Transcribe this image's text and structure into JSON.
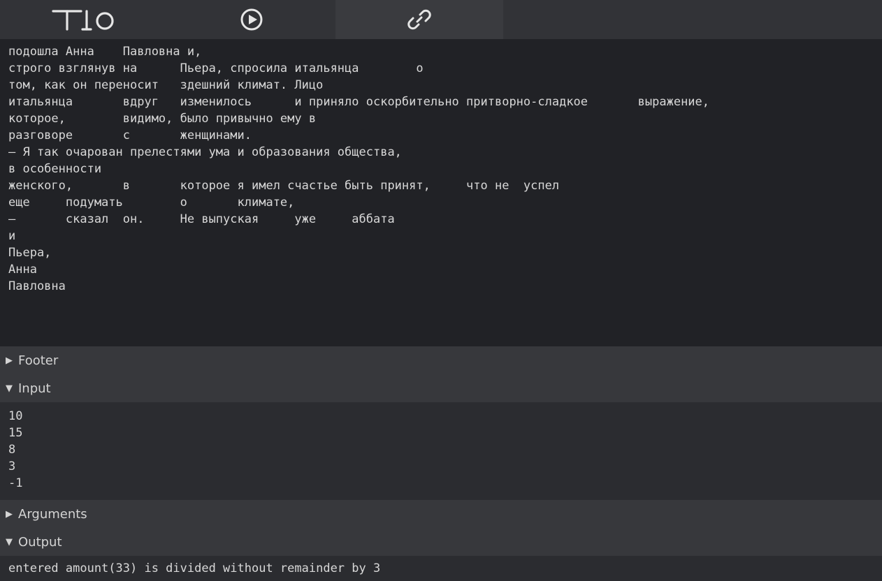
{
  "toolbar": {
    "logo_label": "TIO",
    "run_label": "Run",
    "link_label": "Permalink"
  },
  "sections": {
    "footer": {
      "label": "Footer",
      "expanded": false
    },
    "input": {
      "label": "Input",
      "expanded": true
    },
    "arguments": {
      "label": "Arguments",
      "expanded": false
    },
    "output": {
      "label": "Output",
      "expanded": true
    }
  },
  "code": "подошла Анна    Павловна и,\nстрого взглянув на      Пьера, спросила итальянца        о\nтом, как он переносит   здешний климат. Лицо\nитальянца       вдруг   изменилось      и приняло оскорбительно притворно-сладкое       выражение,\nкоторое,        видимо, было привычно ему в\nразговоре       с       женщинами.\n— Я так очарован прелестями ума и образования общества,\nв особенности\nженского,       в       которое я имел счастье быть принят,     что не  успел\nеще     подумать        о       климате,\n—       сказал  он.     Не выпуская     уже     аббата\nи\nПьера,\nАнна\nПавловна",
  "input": "10\n15\n8\n3\n-1",
  "output": "entered amount(33) is divided without remainder by 3"
}
